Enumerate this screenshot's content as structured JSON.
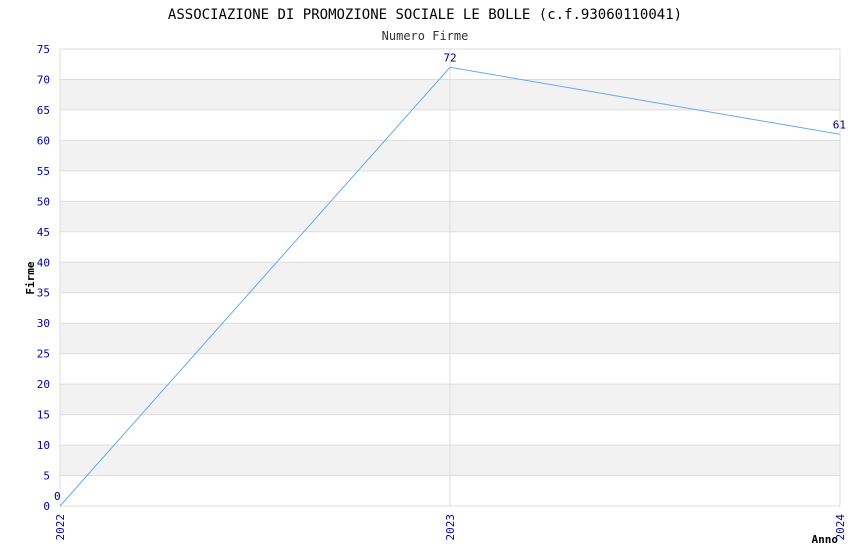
{
  "chart_data": {
    "type": "line",
    "title": "ASSOCIAZIONE DI PROMOZIONE SOCIALE LE BOLLE (c.f.93060110041)",
    "subtitle": "Numero Firme",
    "xlabel": "Anno",
    "ylabel": "Firme",
    "categories": [
      "2022",
      "2023",
      "2024"
    ],
    "series": [
      {
        "values": [
          0,
          72,
          61
        ]
      }
    ],
    "data_labels": [
      "0",
      "72",
      "61"
    ],
    "ylim": [
      0,
      75
    ],
    "yticks": [
      "0",
      "5",
      "10",
      "15",
      "20",
      "25",
      "30",
      "35",
      "40",
      "45",
      "50",
      "55",
      "60",
      "65",
      "70",
      "75"
    ],
    "grid": true,
    "colors": {
      "line": "#66aaee",
      "band": "#f2f2f2",
      "grid": "#dddddd",
      "tick_text": "#0000aa",
      "data_label": "#000066"
    }
  }
}
